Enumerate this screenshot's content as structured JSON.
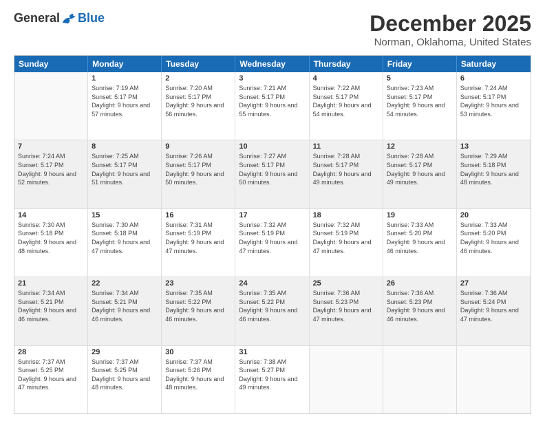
{
  "logo": {
    "general": "General",
    "blue": "Blue"
  },
  "title": "December 2025",
  "location": "Norman, Oklahoma, United States",
  "days": [
    "Sunday",
    "Monday",
    "Tuesday",
    "Wednesday",
    "Thursday",
    "Friday",
    "Saturday"
  ],
  "rows": [
    [
      {
        "day": "",
        "empty": true
      },
      {
        "day": "1",
        "sunrise": "Sunrise: 7:19 AM",
        "sunset": "Sunset: 5:17 PM",
        "daylight": "Daylight: 9 hours and 57 minutes."
      },
      {
        "day": "2",
        "sunrise": "Sunrise: 7:20 AM",
        "sunset": "Sunset: 5:17 PM",
        "daylight": "Daylight: 9 hours and 56 minutes."
      },
      {
        "day": "3",
        "sunrise": "Sunrise: 7:21 AM",
        "sunset": "Sunset: 5:17 PM",
        "daylight": "Daylight: 9 hours and 55 minutes."
      },
      {
        "day": "4",
        "sunrise": "Sunrise: 7:22 AM",
        "sunset": "Sunset: 5:17 PM",
        "daylight": "Daylight: 9 hours and 54 minutes."
      },
      {
        "day": "5",
        "sunrise": "Sunrise: 7:23 AM",
        "sunset": "Sunset: 5:17 PM",
        "daylight": "Daylight: 9 hours and 54 minutes."
      },
      {
        "day": "6",
        "sunrise": "Sunrise: 7:24 AM",
        "sunset": "Sunset: 5:17 PM",
        "daylight": "Daylight: 9 hours and 53 minutes."
      }
    ],
    [
      {
        "day": "7",
        "sunrise": "Sunrise: 7:24 AM",
        "sunset": "Sunset: 5:17 PM",
        "daylight": "Daylight: 9 hours and 52 minutes."
      },
      {
        "day": "8",
        "sunrise": "Sunrise: 7:25 AM",
        "sunset": "Sunset: 5:17 PM",
        "daylight": "Daylight: 9 hours and 51 minutes."
      },
      {
        "day": "9",
        "sunrise": "Sunrise: 7:26 AM",
        "sunset": "Sunset: 5:17 PM",
        "daylight": "Daylight: 9 hours and 50 minutes."
      },
      {
        "day": "10",
        "sunrise": "Sunrise: 7:27 AM",
        "sunset": "Sunset: 5:17 PM",
        "daylight": "Daylight: 9 hours and 50 minutes."
      },
      {
        "day": "11",
        "sunrise": "Sunrise: 7:28 AM",
        "sunset": "Sunset: 5:17 PM",
        "daylight": "Daylight: 9 hours and 49 minutes."
      },
      {
        "day": "12",
        "sunrise": "Sunrise: 7:28 AM",
        "sunset": "Sunset: 5:17 PM",
        "daylight": "Daylight: 9 hours and 49 minutes."
      },
      {
        "day": "13",
        "sunrise": "Sunrise: 7:29 AM",
        "sunset": "Sunset: 5:18 PM",
        "daylight": "Daylight: 9 hours and 48 minutes."
      }
    ],
    [
      {
        "day": "14",
        "sunrise": "Sunrise: 7:30 AM",
        "sunset": "Sunset: 5:18 PM",
        "daylight": "Daylight: 9 hours and 48 minutes."
      },
      {
        "day": "15",
        "sunrise": "Sunrise: 7:30 AM",
        "sunset": "Sunset: 5:18 PM",
        "daylight": "Daylight: 9 hours and 47 minutes."
      },
      {
        "day": "16",
        "sunrise": "Sunrise: 7:31 AM",
        "sunset": "Sunset: 5:19 PM",
        "daylight": "Daylight: 9 hours and 47 minutes."
      },
      {
        "day": "17",
        "sunrise": "Sunrise: 7:32 AM",
        "sunset": "Sunset: 5:19 PM",
        "daylight": "Daylight: 9 hours and 47 minutes."
      },
      {
        "day": "18",
        "sunrise": "Sunrise: 7:32 AM",
        "sunset": "Sunset: 5:19 PM",
        "daylight": "Daylight: 9 hours and 47 minutes."
      },
      {
        "day": "19",
        "sunrise": "Sunrise: 7:33 AM",
        "sunset": "Sunset: 5:20 PM",
        "daylight": "Daylight: 9 hours and 46 minutes."
      },
      {
        "day": "20",
        "sunrise": "Sunrise: 7:33 AM",
        "sunset": "Sunset: 5:20 PM",
        "daylight": "Daylight: 9 hours and 46 minutes."
      }
    ],
    [
      {
        "day": "21",
        "sunrise": "Sunrise: 7:34 AM",
        "sunset": "Sunset: 5:21 PM",
        "daylight": "Daylight: 9 hours and 46 minutes."
      },
      {
        "day": "22",
        "sunrise": "Sunrise: 7:34 AM",
        "sunset": "Sunset: 5:21 PM",
        "daylight": "Daylight: 9 hours and 46 minutes."
      },
      {
        "day": "23",
        "sunrise": "Sunrise: 7:35 AM",
        "sunset": "Sunset: 5:22 PM",
        "daylight": "Daylight: 9 hours and 46 minutes."
      },
      {
        "day": "24",
        "sunrise": "Sunrise: 7:35 AM",
        "sunset": "Sunset: 5:22 PM",
        "daylight": "Daylight: 9 hours and 46 minutes."
      },
      {
        "day": "25",
        "sunrise": "Sunrise: 7:36 AM",
        "sunset": "Sunset: 5:23 PM",
        "daylight": "Daylight: 9 hours and 47 minutes."
      },
      {
        "day": "26",
        "sunrise": "Sunrise: 7:36 AM",
        "sunset": "Sunset: 5:23 PM",
        "daylight": "Daylight: 9 hours and 46 minutes."
      },
      {
        "day": "27",
        "sunrise": "Sunrise: 7:36 AM",
        "sunset": "Sunset: 5:24 PM",
        "daylight": "Daylight: 9 hours and 47 minutes."
      }
    ],
    [
      {
        "day": "28",
        "sunrise": "Sunrise: 7:37 AM",
        "sunset": "Sunset: 5:25 PM",
        "daylight": "Daylight: 9 hours and 47 minutes."
      },
      {
        "day": "29",
        "sunrise": "Sunrise: 7:37 AM",
        "sunset": "Sunset: 5:25 PM",
        "daylight": "Daylight: 9 hours and 48 minutes."
      },
      {
        "day": "30",
        "sunrise": "Sunrise: 7:37 AM",
        "sunset": "Sunset: 5:26 PM",
        "daylight": "Daylight: 9 hours and 48 minutes."
      },
      {
        "day": "31",
        "sunrise": "Sunrise: 7:38 AM",
        "sunset": "Sunset: 5:27 PM",
        "daylight": "Daylight: 9 hours and 49 minutes."
      },
      {
        "day": "",
        "empty": true
      },
      {
        "day": "",
        "empty": true
      },
      {
        "day": "",
        "empty": true
      }
    ]
  ]
}
